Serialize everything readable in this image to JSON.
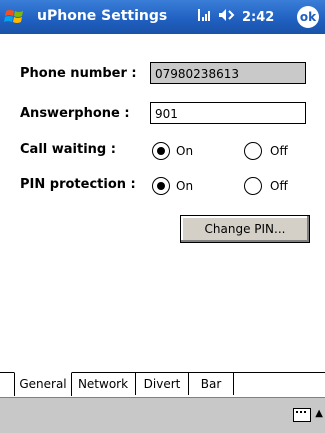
{
  "app": {
    "title": "uPhone Settings",
    "time": "2:42",
    "ok_label": "ok"
  },
  "fields": {
    "phone_label": "Phone number :",
    "phone_value": "07980238613",
    "answerphone_label": "Answerphone :",
    "answerphone_value": "901",
    "call_waiting_label": "Call waiting :",
    "pin_label": "PIN protection :",
    "on_label": "On",
    "off_label": "Off"
  },
  "buttons": {
    "change_pin": "Change PIN..."
  },
  "tabs": [
    {
      "label": "General"
    },
    {
      "label": "Network"
    },
    {
      "label": "Divert"
    },
    {
      "label": "Bar"
    }
  ],
  "colors": {
    "titlebar": "#1f5fc0",
    "bottombar": "#c8c8c8",
    "readonly_field": "#c9c9c9"
  }
}
